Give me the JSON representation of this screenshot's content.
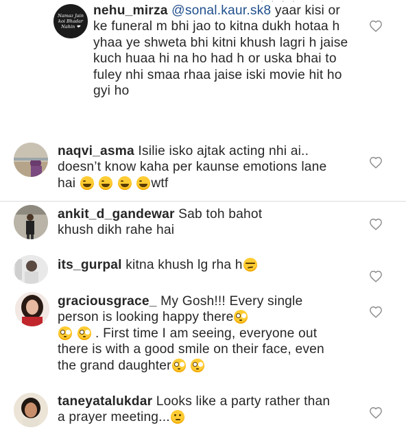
{
  "comments": [
    {
      "username": "nehu_mirza",
      "mention": "@sonal.kaur.sk8",
      "text": " yaar kisi or ke funeral m bhi jao to kitna dukh hotaa h yhaa ye shweta bhi kitni khush lagri h jaise kuch huaa hi na ho had h or uska bhai to fuley nhi smaa rhaa jaise iski movie hit ho gyi ho",
      "avatar_text": "Namaz Jain koi Bhadar Nahin"
    },
    {
      "username": "naqvi_asma",
      "text": " Isilie isko ajtak acting nhi ai.. doesn’t know kaha per kaunse emotions lane hai ",
      "emojis": [
        "joy",
        "joy",
        "joy",
        "joy"
      ],
      "tail": "wtf"
    },
    {
      "username": "ankit_d_gandewar",
      "text": " Sab toh bahot khush dikh rahe hai"
    },
    {
      "username": "its_gurpal",
      "text": " kitna khush lg rha h",
      "emojis": [
        "unamused"
      ]
    },
    {
      "username": "graciousgrace_",
      "text_part1": " My Gosh!!! Every single person is looking happy there",
      "text_part2": " . First time I am seeing, everyone out  there is with a good smile on their face, even the grand daughter"
    },
    {
      "username": "taneyatalukdar",
      "text": " Looks like a party rather than a prayer meeting...",
      "emojis": [
        "thinking"
      ]
    }
  ],
  "icons": {
    "like": "heart-outline-icon",
    "joy": "face-with-tears-of-joy-icon",
    "flushed": "flushed-face-icon",
    "unamused": "unamused-face-icon",
    "thinking": "thinking-face-icon"
  },
  "colors": {
    "mention": "#1f4e8c",
    "text": "#262626",
    "divider": "#dbdbdb",
    "heart": "#8e8e8e"
  }
}
